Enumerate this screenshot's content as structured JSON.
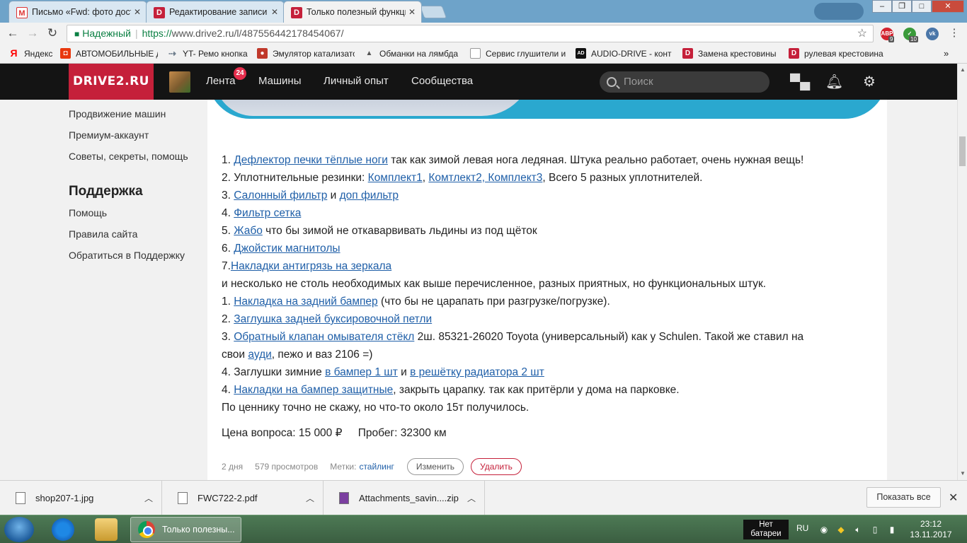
{
  "browser": {
    "tabs": [
      {
        "title": "Письмо «Fwd: фото доставки",
        "icon": "gmail-icon"
      },
      {
        "title": "Редактирование записи",
        "icon": "drive2-icon"
      },
      {
        "title": "Только полезный функционал",
        "icon": "drive2-icon"
      }
    ],
    "secure_label": "Надежный",
    "url_proto": "https://",
    "url_rest": "www.drive2.ru/l/487556442178454067/",
    "extensions": [
      {
        "icon": "abp-icon",
        "badge": "9"
      },
      {
        "icon": "check-icon",
        "badge": "10"
      },
      {
        "icon": "vk-icon",
        "badge": ""
      }
    ],
    "bookmarks": [
      {
        "label": "Яндекс",
        "icon": "yandex-icon",
        "color": "#ff0000"
      },
      {
        "label": "АВТОМОБИЛЬНЫЕ д",
        "icon": "shop-icon",
        "color": "#e8380d"
      },
      {
        "label": "YT- Ремо кнопка",
        "icon": "link-icon",
        "color": "#6e7d8c"
      },
      {
        "label": "Эмулятор катализато",
        "icon": "car-icon",
        "color": "#c0392b"
      },
      {
        "label": "Обманки на лямбда",
        "icon": "car-icon",
        "color": "#555555"
      },
      {
        "label": "Сервис глушители и",
        "icon": "page-icon",
        "color": "#999999"
      },
      {
        "label": "AUDIO-DRIVE - конт",
        "icon": "ad-icon",
        "color": "#111111"
      },
      {
        "label": "Замена крестовины",
        "icon": "drive2-icon",
        "color": "#c5203a"
      },
      {
        "label": "рулевая крестовина",
        "icon": "drive2-icon",
        "color": "#c5203a"
      }
    ]
  },
  "site": {
    "logo": "DRIVE2.RU",
    "nav": [
      {
        "label": "Лента",
        "badge": "24"
      },
      {
        "label": "Машины"
      },
      {
        "label": "Личный опыт"
      },
      {
        "label": "Сообщества"
      }
    ],
    "search_placeholder": "Поиск"
  },
  "sidebar": {
    "links_top": [
      "Продвижение машин",
      "Премиум-аккаунт",
      "Советы, секреты, помощь"
    ],
    "support_heading": "Поддержка",
    "links_support": [
      "Помощь",
      "Правила сайта",
      "Обратиться в Поддержку"
    ]
  },
  "article": {
    "lines": [
      [
        {
          "t": "1. "
        },
        {
          "t": "Дефлектор печки тёплые ноги",
          "link": true
        },
        {
          "t": " так как зимой левая нога ледяная. Штука реально работает, очень нужная вещь!"
        }
      ],
      [
        {
          "t": "2. Уплотнительные резинки: "
        },
        {
          "t": "Комплект1",
          "link": true
        },
        {
          "t": ", "
        },
        {
          "t": "Комтлект2, Комплект3",
          "link": true
        },
        {
          "t": ", Всего 5 разных уплотнителей."
        }
      ],
      [
        {
          "t": "3. "
        },
        {
          "t": "Салонный фильтр",
          "link": true
        },
        {
          "t": " и "
        },
        {
          "t": "доп фильтр",
          "link": true
        }
      ],
      [
        {
          "t": "4. "
        },
        {
          "t": "Фильтр сетка",
          "link": true
        }
      ],
      [
        {
          "t": "5. "
        },
        {
          "t": "Жабо",
          "link": true
        },
        {
          "t": " что бы зимой не откаварвивать льдины из под щёток"
        }
      ],
      [
        {
          "t": "6. "
        },
        {
          "t": "Джойстик магнитолы",
          "link": true
        }
      ],
      [
        {
          "t": "7."
        },
        {
          "t": "Накладки антигрязь на зеркала",
          "link": true
        }
      ],
      [
        {
          "t": "и несколько не столь необходимых как выше перечисленное, разных приятных, но функциональных штук."
        }
      ],
      [
        {
          "t": "1. "
        },
        {
          "t": "Накладка на задний бампер",
          "link": true
        },
        {
          "t": " (что бы не царапать при разгрузке/погрузке)."
        }
      ],
      [
        {
          "t": "2. "
        },
        {
          "t": "Заглушка задней буксировочной петли",
          "link": true
        }
      ],
      [
        {
          "t": "3. "
        },
        {
          "t": "Обратный клапан омывателя стёкл",
          "link": true
        },
        {
          "t": " 2ш. 85321-26020 Toyota (универсальный) как у Schulen. Такой же ставил на"
        }
      ],
      [
        {
          "t": "свои "
        },
        {
          "t": "ауди",
          "link": true
        },
        {
          "t": ", пежо и ваз 2106 =)"
        }
      ],
      [
        {
          "t": "4. Заглушки зимние "
        },
        {
          "t": "в бампер 1 шт",
          "link": true
        },
        {
          "t": " и "
        },
        {
          "t": "в решётку радиатора 2 шт",
          "link": true
        }
      ],
      [
        {
          "t": "4. "
        },
        {
          "t": "Накладки на бампер защитные",
          "link": true
        },
        {
          "t": ", закрыть царапку. так как притёрли у дома на парковке."
        }
      ],
      [
        {
          "t": "По ценнику точно не скажу, но что-то около 15т получилось."
        }
      ]
    ],
    "price_label": "Цена вопроса:",
    "price_value": "15 000 ₽",
    "mileage_label": "Пробег:",
    "mileage_value": "32300 км",
    "age": "2 дня",
    "views": "579 просмотров",
    "tags_label": "Метки:",
    "tag": "стайлинг",
    "edit_label": "Изменить",
    "delete_label": "Удалить"
  },
  "downloads": {
    "items": [
      "shop207-1.jpg",
      "FWC722-2.pdf",
      "Attachments_savin....zip"
    ],
    "show_all": "Показать все"
  },
  "taskbar": {
    "task_title": "Только полезны...",
    "battery_tip": "Нет батареи",
    "lang": "RU",
    "time": "23:12",
    "date": "13.11.2017"
  }
}
